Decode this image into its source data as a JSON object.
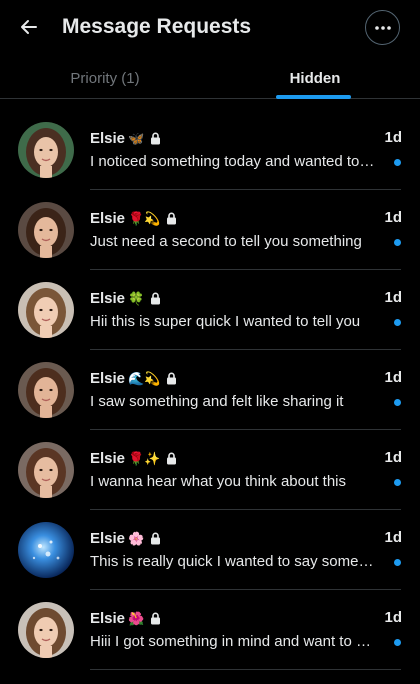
{
  "header": {
    "title": "Message Requests",
    "back_icon": "arrow-left-icon",
    "more_icon": "more-horizontal-icon"
  },
  "tabs": [
    {
      "label": "Priority (1)",
      "active": false
    },
    {
      "label": "Hidden",
      "active": true
    }
  ],
  "colors": {
    "background": "#000000",
    "accent": "#1d9bf0",
    "text": "#e7e9ea",
    "muted": "#71767b",
    "divider": "#2f3336"
  },
  "conversations": [
    {
      "name": "Elsie",
      "emojis": [
        "🦋"
      ],
      "locked": true,
      "time": "1d",
      "preview": "I noticed something today and wanted to tell you",
      "unread": true
    },
    {
      "name": "Elsie",
      "emojis": [
        "🌹",
        "💫"
      ],
      "locked": true,
      "time": "1d",
      "preview": "Just need a second to tell you something",
      "unread": true
    },
    {
      "name": "Elsie",
      "emojis": [
        "🍀"
      ],
      "locked": true,
      "time": "1d",
      "preview": "Hii this is super quick I wanted to tell you",
      "unread": true
    },
    {
      "name": "Elsie",
      "emojis": [
        "🌊",
        "💫"
      ],
      "locked": true,
      "time": "1d",
      "preview": "I saw something and felt like sharing it",
      "unread": true
    },
    {
      "name": "Elsie",
      "emojis": [
        "🌹",
        "✨"
      ],
      "locked": true,
      "time": "1d",
      "preview": "I wanna hear what you think about this",
      "unread": true
    },
    {
      "name": "Elsie",
      "emojis": [
        "🌸"
      ],
      "locked": true,
      "time": "1d",
      "preview": "This is really quick I wanted to say something",
      "unread": true
    },
    {
      "name": "Elsie",
      "emojis": [
        "🌺"
      ],
      "locked": true,
      "time": "1d",
      "preview": "Hiii I got something in mind and want to share",
      "unread": true
    }
  ]
}
